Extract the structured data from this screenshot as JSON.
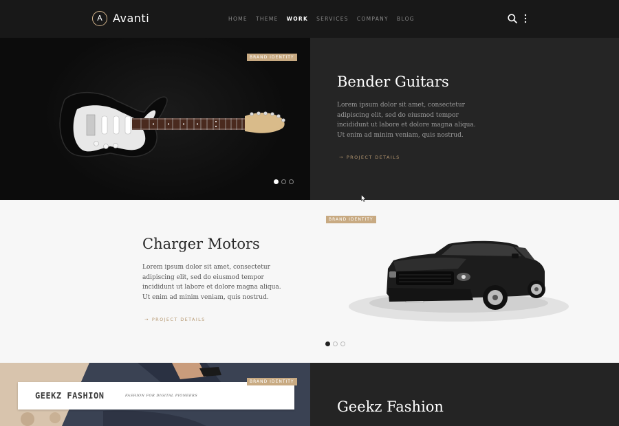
{
  "brand": {
    "mark": "A",
    "name": "Avanti"
  },
  "nav": [
    {
      "label": "HOME",
      "active": false
    },
    {
      "label": "THEME",
      "active": false
    },
    {
      "label": "WORK",
      "active": true
    },
    {
      "label": "SERVICES",
      "active": false
    },
    {
      "label": "COMPANY",
      "active": false
    },
    {
      "label": "BLOG",
      "active": false
    }
  ],
  "header_icons": [
    "search-icon",
    "more-vertical-icon"
  ],
  "projects": [
    {
      "badge": "BRAND IDENTITY",
      "title": "Bender Guitars",
      "description": "Lorem ipsum dolor sit amet, consectetur adipiscing elit, sed do eiusmod tempor incididunt ut labore et dolore magna aliqua. Ut enim ad minim veniam, quis nostrud.",
      "link": "PROJECT DETAILS",
      "slides": 3,
      "active_slide": 1
    },
    {
      "badge": "BRAND IDENTITY",
      "title": "Charger Motors",
      "description": "Lorem ipsum dolor sit amet, consectetur adipiscing elit, sed do eiusmod tempor incididunt ut labore et dolore magna aliqua. Ut enim ad minim veniam, quis nostrud.",
      "link": "PROJECT DETAILS",
      "slides": 3,
      "active_slide": 1
    },
    {
      "badge": "BRAND IDENTITY",
      "title": "Geekz Fashion",
      "card_logo": "GEEKZ FASHION",
      "card_tagline": "FASHION FOR DIGITAL PIONEERS"
    }
  ],
  "colors": {
    "accent": "#c8aa82",
    "dark": "#252525",
    "light": "#f7f7f7",
    "header": "#181818"
  }
}
